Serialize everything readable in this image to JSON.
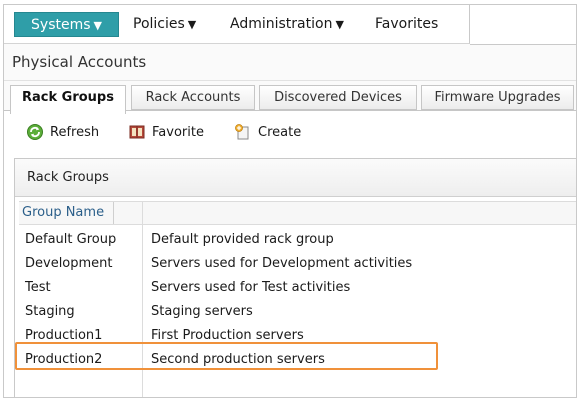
{
  "nav": {
    "systems": "Systems",
    "policies": "Policies",
    "administration": "Administration",
    "favorites": "Favorites"
  },
  "page_title": "Physical Accounts",
  "tabs": [
    {
      "label": "Rack Groups",
      "active": true
    },
    {
      "label": "Rack Accounts",
      "active": false
    },
    {
      "label": "Discovered Devices",
      "active": false
    },
    {
      "label": "Firmware Upgrades",
      "active": false
    }
  ],
  "toolbar": {
    "refresh": "Refresh",
    "favorite": "Favorite",
    "create": "Create"
  },
  "panel": {
    "title": "Rack Groups",
    "columns": [
      "Group Name",
      ""
    ],
    "rows": [
      {
        "name": "Default Group",
        "description": "Default provided rack group"
      },
      {
        "name": "Development",
        "description": "Servers used for Development activities"
      },
      {
        "name": "Test",
        "description": "Servers used for Test activities"
      },
      {
        "name": "Staging",
        "description": "Staging servers"
      },
      {
        "name": "Production1",
        "description": "First Production servers"
      },
      {
        "name": "Production2",
        "description": "Second production servers",
        "highlighted": true
      }
    ]
  },
  "colors": {
    "accent": "#2f9ea8",
    "highlight": "#f0913a",
    "column_header_text": "#2b5f8a"
  },
  "icons": {
    "caret": "caret-down-icon",
    "refresh": "refresh-icon",
    "favorite": "favorite-book-icon",
    "create": "create-icon"
  }
}
